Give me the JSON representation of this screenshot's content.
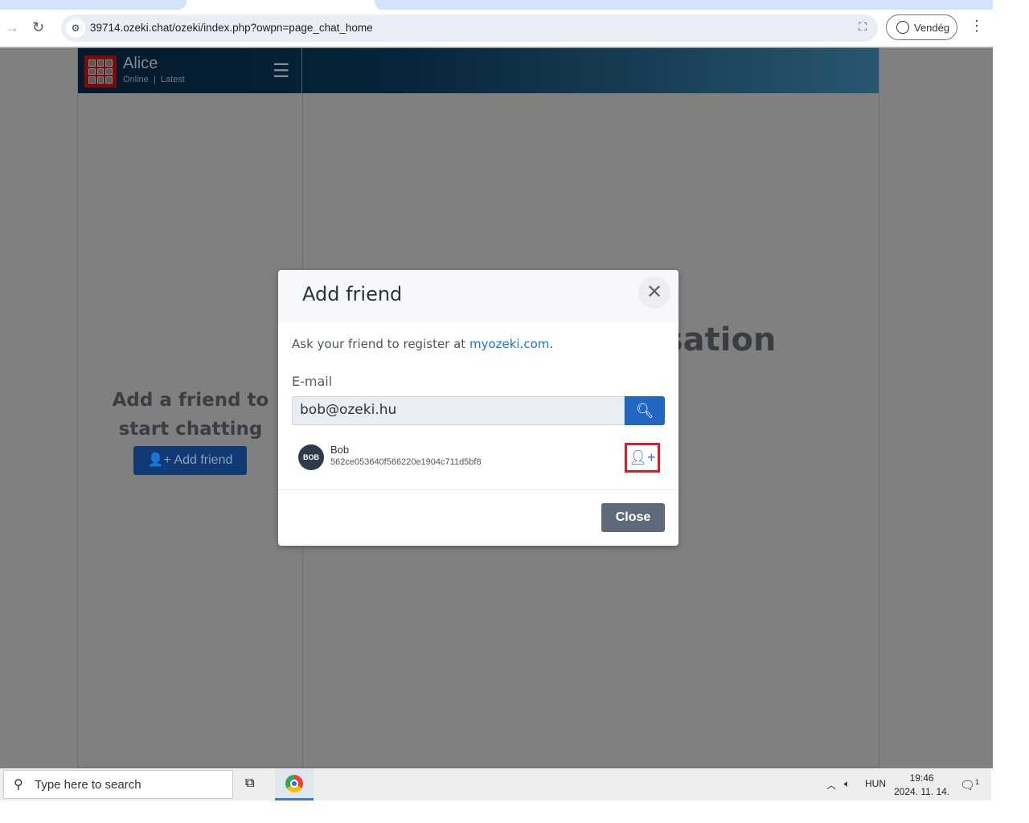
{
  "browser": {
    "url": "39714.ozeki.chat/ozeki/index.php?owpn=page_chat_home",
    "profile_label": "Vendég"
  },
  "app": {
    "user_name": "Alice",
    "status": "Online",
    "separator": "|",
    "latest": "Latest",
    "empty_sidebar_text": "Add a friend to start chatting",
    "add_friend_label": "Add friend",
    "conversation_text": "Start a conversation"
  },
  "modal": {
    "title": "Add friend",
    "ask_text": "Ask your friend to register at ",
    "ask_link": "myozeki.com",
    "ask_end": ".",
    "email_label": "E-mail",
    "email_value": "bob@ozeki.hu",
    "result": {
      "avatar": "BOB",
      "name": "Bob",
      "id": "562ce053640f566220e1904c711d5bf8"
    },
    "close_label": "Close"
  },
  "taskbar": {
    "search_placeholder": "Type here to search",
    "language": "HUN",
    "time": "19:46",
    "date": "2024. 11. 14.",
    "notifications": "1"
  },
  "colors": {
    "header": "#06243a",
    "primary": "#2266c4",
    "highlight": "#e01b24"
  }
}
